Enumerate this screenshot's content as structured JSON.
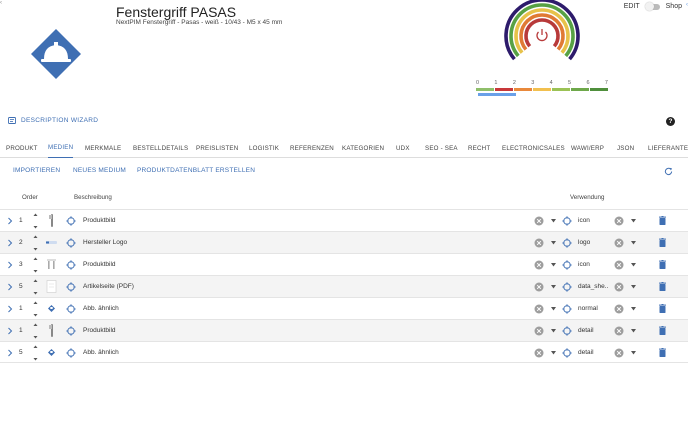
{
  "header": {
    "title": "Fenstergriff PASAS",
    "subtitle": "NextPIM Fenstergriff - Pasas - weiß - 10/43 - M5 x 45 mm",
    "edit_label": "EDIT",
    "shop_label": "Shop"
  },
  "energy_scale": {
    "labels": [
      "0",
      "1",
      "2",
      "3",
      "4",
      "5",
      "6",
      "7"
    ],
    "colors": [
      "#8fbf6a",
      "#c8383a",
      "#e9893b",
      "#f2c04f",
      "#9bc255",
      "#6ea84a",
      "#4f8f3c"
    ],
    "selected_color": "#6aa0e8",
    "gauge_colors": [
      "#2d1b6b",
      "#57a144",
      "#e7c24a",
      "#e07a34",
      "#b83a3a"
    ]
  },
  "wizard": {
    "label": "DESCRIPTION WIZARD"
  },
  "help_label": "?",
  "tabs": [
    {
      "label": "PRODUKT"
    },
    {
      "label": "MEDIEN"
    },
    {
      "label": "MERKMALE"
    },
    {
      "label": "BESTELLDETAILS"
    },
    {
      "label": "PREISLISTEN"
    },
    {
      "label": "LOGISTIK"
    },
    {
      "label": "REFERENZEN"
    },
    {
      "label": "KATEGORIEN"
    },
    {
      "label": "UDX"
    },
    {
      "label": "SEO - SEA"
    },
    {
      "label": "RECHT"
    },
    {
      "label": "ELECTRONICSALES"
    },
    {
      "label": "WAWI/ERP"
    },
    {
      "label": "JSON"
    },
    {
      "label": "LIEFERANTEN"
    }
  ],
  "active_tab": "MEDIEN",
  "actions": {
    "import": "IMPORTIEREN",
    "new_media": "NEUES MEDIUM",
    "datasheet": "PRODUKTDATENBLATT ERSTELLEN"
  },
  "table": {
    "headers": {
      "order": "Order",
      "description": "Beschreibung",
      "usage": "Verwendung"
    },
    "rows": [
      {
        "order": "1",
        "thumb": "handle-thumb",
        "description": "Produktbild",
        "usage": "icon"
      },
      {
        "order": "2",
        "thumb": "logo-thumb",
        "description": "Hersteller Logo",
        "usage": "logo"
      },
      {
        "order": "3",
        "thumb": "handle-pair-thumb",
        "description": "Produktbild",
        "usage": "icon"
      },
      {
        "order": "5",
        "thumb": "pdf-thumb",
        "description": "Artikelseite (PDF)",
        "usage": "data_she..."
      },
      {
        "order": "1",
        "thumb": "diamond-thumb",
        "description": "Abb. ähnlich",
        "usage": "normal"
      },
      {
        "order": "1",
        "thumb": "handle-thumb",
        "description": "Produktbild",
        "usage": "detail"
      },
      {
        "order": "5",
        "thumb": "diamond-thumb",
        "description": "Abb. ähnlich",
        "usage": "detail"
      }
    ]
  }
}
